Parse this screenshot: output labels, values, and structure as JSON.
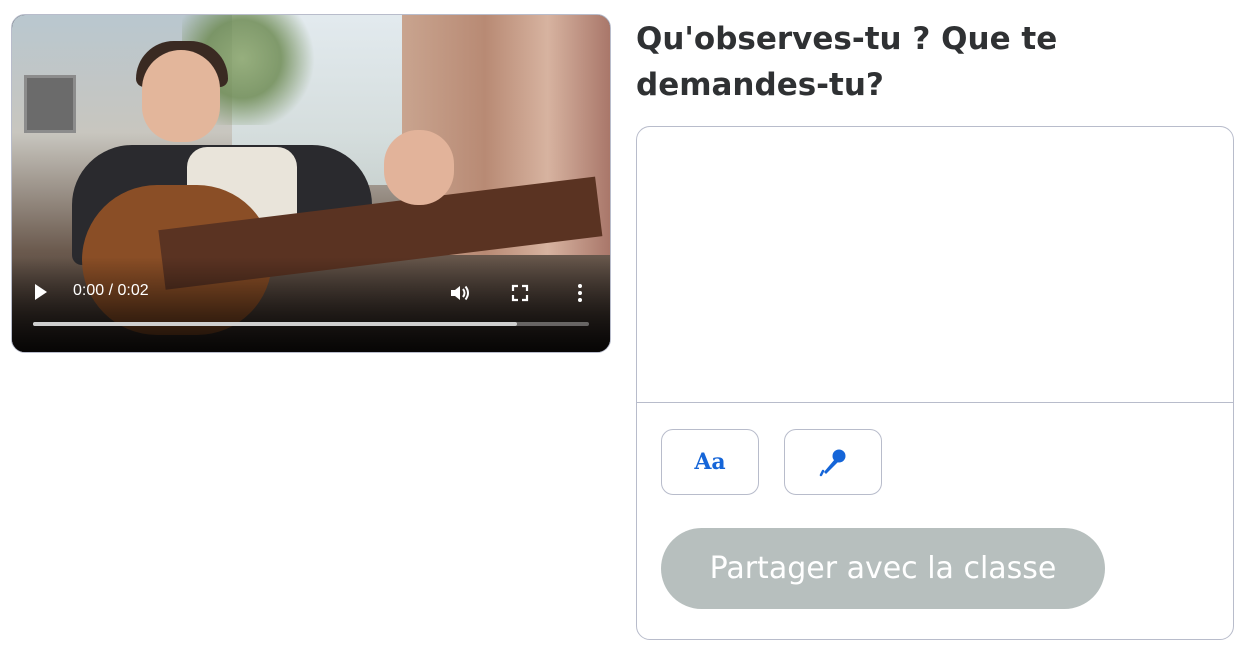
{
  "video": {
    "time_display": "0:00 / 0:02",
    "progress_fraction": 0.0,
    "buffered_fraction": 0.87,
    "controls": {
      "play_icon": "play-icon",
      "volume_icon": "volume-icon",
      "fullscreen_icon": "fullscreen-icon",
      "more_icon": "more-options-icon"
    }
  },
  "question": {
    "title": "Qu'observes-tu ? Que te demandes-tu?"
  },
  "answer": {
    "value": "",
    "text_tool_label": "Aa",
    "mic_icon": "microphone-icon",
    "share_label": "Partager avec la classe"
  },
  "colors": {
    "accent": "#1565d8",
    "share_disabled": "#b7bfbe",
    "border": "#b8bccb",
    "heading": "#2f3133"
  }
}
